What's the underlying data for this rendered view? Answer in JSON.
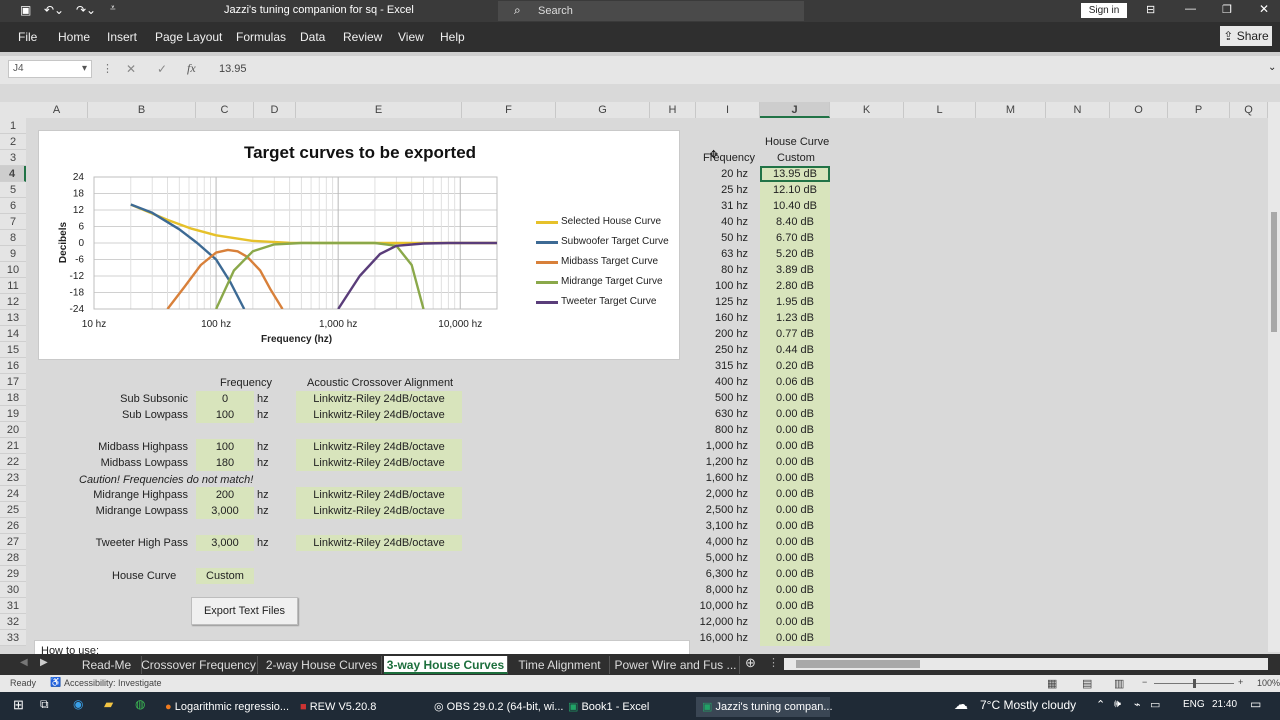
{
  "window": {
    "title": "Jazzi's tuning companion for sq  -  Excel",
    "search_placeholder": "Search",
    "sign_in": "Sign in",
    "share": "Share"
  },
  "ribbon": [
    "File",
    "Home",
    "Insert",
    "Page Layout",
    "Formulas",
    "Data",
    "Review",
    "View",
    "Help"
  ],
  "formula_bar": {
    "name_box": "J4",
    "value": "13.95",
    "fx": "fx"
  },
  "columns": [
    "A",
    "B",
    "C",
    "D",
    "E",
    "F",
    "G",
    "H",
    "I",
    "J",
    "K",
    "L",
    "M",
    "N",
    "O",
    "P",
    "Q"
  ],
  "rows": [
    "1",
    "2",
    "3",
    "4",
    "5",
    "6",
    "7",
    "8",
    "9",
    "10",
    "11",
    "12",
    "13",
    "14",
    "15",
    "16",
    "17",
    "18",
    "19",
    "20",
    "21",
    "22",
    "23",
    "24",
    "25",
    "26",
    "27",
    "28",
    "29",
    "30",
    "31",
    "32",
    "33"
  ],
  "chart": {
    "title": "Target curves to be exported",
    "ylabel": "Decibels",
    "xlabel": "Frequency (hz)",
    "y_ticks": [
      "24",
      "18",
      "12",
      "6",
      "0",
      "-6",
      "-12",
      "-18",
      "-24"
    ],
    "x_ticks": [
      "10 hz",
      "100 hz",
      "1,000 hz",
      "10,000 hz"
    ],
    "legend": [
      {
        "name": "Selected House Curve",
        "color": "#e6c12a"
      },
      {
        "name": "Subwoofer Target Curve",
        "color": "#3d6a94"
      },
      {
        "name": "Midbass Target Curve",
        "color": "#d8803a"
      },
      {
        "name": "Midrange Target Curve",
        "color": "#8aa84a"
      },
      {
        "name": "Tweeter Target Curve",
        "color": "#5a3d7a"
      }
    ]
  },
  "chart_data": {
    "type": "line",
    "title": "Target curves to be exported",
    "xlabel": "Frequency (hz)",
    "ylabel": "Decibels",
    "x_scale": "log",
    "xlim": [
      10,
      20000
    ],
    "ylim": [
      -24,
      24
    ],
    "series": [
      {
        "name": "Selected House Curve",
        "x": [
          20,
          40,
          63,
          100,
          200,
          400,
          800,
          2000,
          20000
        ],
        "values": [
          13.95,
          8.4,
          5.2,
          2.8,
          0.77,
          0.06,
          0,
          0,
          0
        ]
      },
      {
        "name": "Subwoofer Target Curve",
        "x": [
          20,
          30,
          50,
          70,
          100,
          130,
          170
        ],
        "values": [
          14,
          11,
          5,
          0,
          -6,
          -14,
          -24
        ]
      },
      {
        "name": "Midbass Target Curve",
        "x": [
          40,
          55,
          75,
          100,
          125,
          150,
          180,
          230,
          280,
          350
        ],
        "values": [
          -24,
          -16,
          -8,
          -3.5,
          -2.5,
          -3,
          -5,
          -10,
          -17,
          -24
        ]
      },
      {
        "name": "Midrange Target Curve",
        "x": [
          100,
          140,
          200,
          300,
          500,
          1000,
          2000,
          3000,
          4000,
          5000
        ],
        "values": [
          -24,
          -10,
          -3,
          -0.5,
          0,
          0,
          0,
          -1,
          -8,
          -24
        ]
      },
      {
        "name": "Tweeter Target Curve",
        "x": [
          1000,
          1500,
          2200,
          3000,
          5000,
          8000,
          20000
        ],
        "values": [
          -24,
          -12,
          -4,
          -1,
          -0.2,
          0,
          0
        ]
      }
    ]
  },
  "settings": {
    "headers": {
      "frequency": "Frequency",
      "alignment": "Acoustic Crossover Alignment"
    },
    "rows": [
      {
        "label": "Sub Subsonic",
        "value": "0",
        "unit": "hz",
        "alignment": "Linkwitz-Riley 24dB/octave"
      },
      {
        "label": "Sub  Lowpass",
        "value": "100",
        "unit": "hz",
        "alignment": "Linkwitz-Riley 24dB/octave"
      },
      {
        "label": "Midbass Highpass",
        "value": "100",
        "unit": "hz",
        "alignment": "Linkwitz-Riley 24dB/octave"
      },
      {
        "label": "Midbass Lowpass",
        "value": "180",
        "unit": "hz",
        "alignment": "Linkwitz-Riley 24dB/octave"
      },
      {
        "label": "Midrange Highpass",
        "value": "200",
        "unit": "hz",
        "alignment": "Linkwitz-Riley 24dB/octave"
      },
      {
        "label": "Midrange Lowpass",
        "value": "3,000",
        "unit": "hz",
        "alignment": "Linkwitz-Riley 24dB/octave"
      },
      {
        "label": "Tweeter High Pass",
        "value": "3,000",
        "unit": "hz",
        "alignment": "Linkwitz-Riley 24dB/octave"
      }
    ],
    "caution": "Caution! Frequencies do not match!",
    "house_curve_label": "House Curve",
    "house_curve_value": "Custom",
    "export_button": "Export Text Files",
    "how_to": "How to use:"
  },
  "house_table": {
    "header_freq": "Frequency",
    "header_curve_1": "House Curve",
    "header_curve_2": "Custom",
    "rows": [
      [
        "20 hz",
        "13.95 dB"
      ],
      [
        "25 hz",
        "12.10 dB"
      ],
      [
        "31 hz",
        "10.40 dB"
      ],
      [
        "40 hz",
        "8.40 dB"
      ],
      [
        "50 hz",
        "6.70 dB"
      ],
      [
        "63 hz",
        "5.20 dB"
      ],
      [
        "80 hz",
        "3.89 dB"
      ],
      [
        "100 hz",
        "2.80 dB"
      ],
      [
        "125 hz",
        "1.95 dB"
      ],
      [
        "160 hz",
        "1.23 dB"
      ],
      [
        "200 hz",
        "0.77 dB"
      ],
      [
        "250 hz",
        "0.44 dB"
      ],
      [
        "315 hz",
        "0.20 dB"
      ],
      [
        "400 hz",
        "0.06 dB"
      ],
      [
        "500 hz",
        "0.00 dB"
      ],
      [
        "630 hz",
        "0.00 dB"
      ],
      [
        "800 hz",
        "0.00 dB"
      ],
      [
        "1,000 hz",
        "0.00 dB"
      ],
      [
        "1,200 hz",
        "0.00 dB"
      ],
      [
        "1,600 hz",
        "0.00 dB"
      ],
      [
        "2,000 hz",
        "0.00 dB"
      ],
      [
        "2,500 hz",
        "0.00 dB"
      ],
      [
        "3,100 hz",
        "0.00 dB"
      ],
      [
        "4,000 hz",
        "0.00 dB"
      ],
      [
        "5,000 hz",
        "0.00 dB"
      ],
      [
        "6,300 hz",
        "0.00 dB"
      ],
      [
        "8,000 hz",
        "0.00 dB"
      ],
      [
        "10,000 hz",
        "0.00 dB"
      ],
      [
        "12,000 hz",
        "0.00 dB"
      ],
      [
        "16,000 hz",
        "0.00 dB"
      ]
    ]
  },
  "sheet_tabs": [
    "Read-Me",
    "Crossover Frequency",
    "2-way House Curves",
    "3-way House Curves",
    "Time Alignment",
    "Power Wire and Fus ..."
  ],
  "active_sheet": "3-way House Curves",
  "status": {
    "ready": "Ready",
    "accessibility": "Accessibility: Investigate",
    "zoom": "100%"
  },
  "taskbar": {
    "apps": [
      "Logarithmic regressio...",
      "REW V5.20.8",
      "OBS 29.0.2 (64-bit, wi...",
      "Book1 - Excel",
      "Jazzi's tuning compan..."
    ],
    "weather": "7°C  Mostly cloudy",
    "lang": "ENG",
    "time": "21:40"
  }
}
